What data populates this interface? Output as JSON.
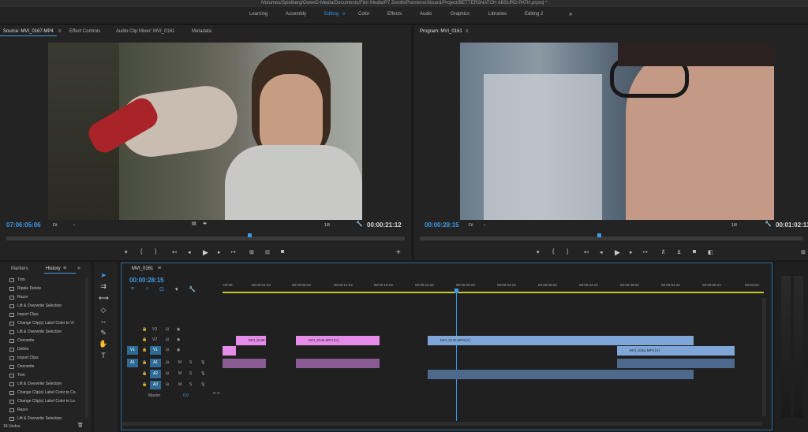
{
  "window": {
    "title": "/Volumes/Spielberg/OwenD-Media/Documents/Film Media/P7 Zenith/Premiere/Absurd/Project/BETTERSNATCH ABSURD PATH.prproj *"
  },
  "workspaces": [
    "Learning",
    "Assembly",
    "Editing",
    "Color",
    "Effects",
    "Audio",
    "Graphics",
    "Libraries",
    "Editing 2"
  ],
  "workspace_active": "Editing",
  "workspace_more": "»",
  "source_panel": {
    "tabs": [
      "Source: MVI_0167.MP4",
      "Effect Controls",
      "Audio Clip Mixer: MVI_0161",
      "Metadata"
    ],
    "timecode_left": "07:06:05:06",
    "fit": "Fit",
    "resolution": "1/8",
    "timecode_right": "00:00:21:12"
  },
  "program_panel": {
    "title": "Program: MVI_0161",
    "timecode_left": "00:00:28:15",
    "fit": "Fit",
    "resolution": "1/8",
    "timecode_right": "00:01:02:13"
  },
  "history_panel": {
    "tabs": [
      "Markers",
      "History"
    ],
    "items": [
      "Trim",
      "Ripple Delete",
      "Razor",
      "Lift & Overwrite Selection",
      "Import Clips",
      "Change Clip(s) Label Color to Vi",
      "Lift & Overwrite Selection",
      "Overwrite",
      "Delete",
      "Import Clips",
      "Overwrite",
      "Trim",
      "Lift & Overwrite Selection",
      "Change Clip(s) Label Color to Ca",
      "Change Clip(s) Label Color to La",
      "Razor",
      "Lift & Overwrite Selection"
    ],
    "undos": "18 Undos"
  },
  "timeline": {
    "tab": "MVI_0161",
    "timecode": "00:00:28:15",
    "ruler": [
      ":00:00",
      "00:00:04:23",
      "00:00:09:23",
      "00:00:14:23",
      "00:00:19:23",
      "00:00:24:23",
      "00:00:29:23",
      "00:00:34:23",
      "00:00:39:23",
      "00:00:44:22",
      "00:00:49:22",
      "00:00:54:22",
      "00:00:59:22",
      "00:01:04:"
    ],
    "tracks_video": [
      "V3",
      "V2",
      "V1"
    ],
    "tracks_audio": [
      "A1",
      "A2",
      "A3"
    ],
    "master": "Master",
    "master_value": "0.0",
    "clips": {
      "v2_a": "MVI_0146",
      "v2_b": "MVI_0146.MP4 [V]",
      "v2_c": "MVI_0140.MP4 [V]",
      "v1_d": "MVI_0151.MP4 [V]"
    }
  },
  "colors": {
    "accent": "#2f96e8",
    "clip_violet": "#e58ce8",
    "clip_blue": "#7ea7d8"
  }
}
